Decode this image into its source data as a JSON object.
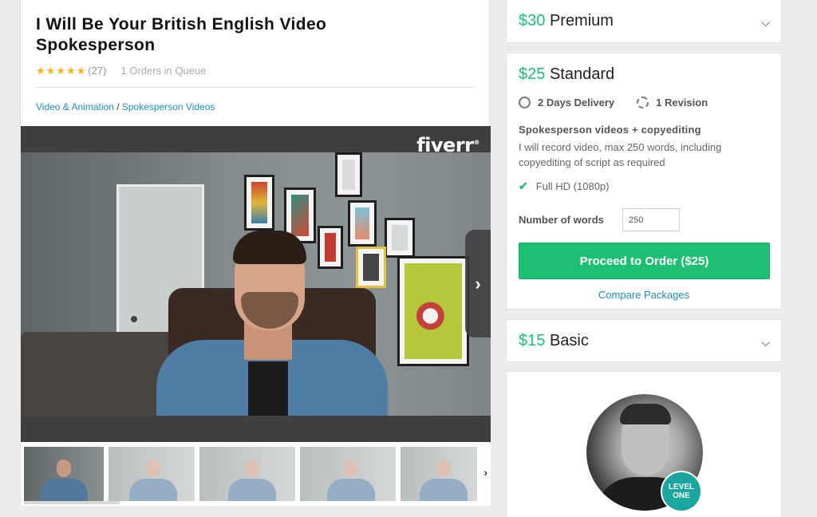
{
  "gig": {
    "title": "I Will Be Your British English Video Spokesperson",
    "rating_stars": 5,
    "rating_count": "(27)",
    "queue": "1 Orders in Queue",
    "breadcrumb": {
      "category": "Video & Animation",
      "separator": " / ",
      "subcategory": "Spokesperson Videos"
    }
  },
  "media": {
    "logo": "fiverr",
    "logo_mark": "®",
    "next_icon": "chevron-right-icon",
    "thumbs_next_icon": "chevron-right-icon"
  },
  "packages": {
    "premium": {
      "price": "$30",
      "name": "Premium"
    },
    "standard": {
      "price": "$25",
      "name": "Standard",
      "delivery": "2 Days Delivery",
      "revision": "1 Revision",
      "subtitle": "Spokesperson videos + copyediting",
      "description": "I will record video, max 250 words, including copyediting of script as required",
      "feature": "Full HD (1080p)",
      "words_label": "Number of words",
      "words_value": "250",
      "order_button": "Proceed to Order ($25)",
      "compare_link": "Compare Packages"
    },
    "basic": {
      "price": "$15",
      "name": "Basic"
    }
  },
  "seller": {
    "badge_line1": "LEVEL",
    "badge_line2": "ONE"
  },
  "colors": {
    "accent": "#1dbf73",
    "link": "#1d8fb5",
    "star": "#f1b41c",
    "badge": "#1aa59f"
  }
}
